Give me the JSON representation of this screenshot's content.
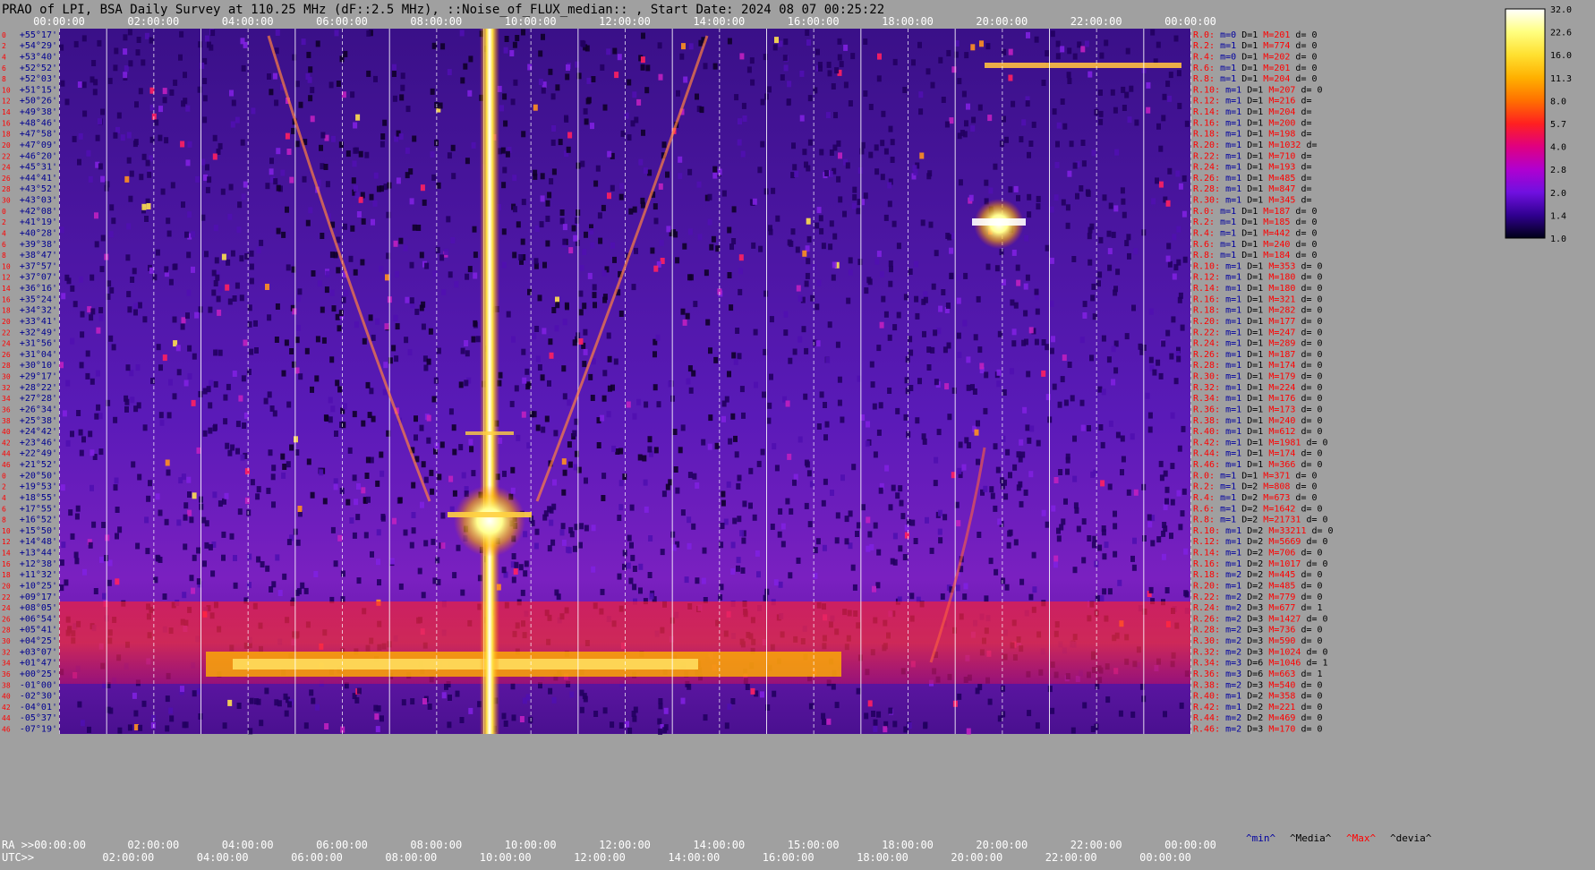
{
  "chart_data": {
    "type": "heatmap",
    "title": "PRAO of LPI, BSA Daily Survey at 110.25 MHz (dF::2.5 MHz), ::Noise_of_FLUX_median:: , Start Date: 2024 08 07 00:25:22",
    "x_top_ticks": [
      "00:00:00",
      "02:00:00",
      "04:00:00",
      "06:00:00",
      "08:00:00",
      "10:00:00",
      "12:00:00",
      "14:00:00",
      "16:00:00",
      "18:00:00",
      "20:00:00",
      "22:00:00",
      "00:00:00"
    ],
    "ra_label": "RA >>00:00:00",
    "ra_ticks": [
      "02:00:00",
      "04:00:00",
      "06:00:00",
      "08:00:00",
      "10:00:00",
      "12:00:00",
      "14:00:00",
      "15:00:00",
      "18:00:00",
      "20:00:00",
      "22:00:00",
      "00:00:00"
    ],
    "utc_label": "UTC>>",
    "utc_ticks": [
      "02:00:00",
      "04:00:00",
      "06:00:00",
      "08:00:00",
      "10:00:00",
      "12:00:00",
      "14:00:00",
      "16:00:00",
      "18:00:00",
      "20:00:00",
      "22:00:00",
      "00:00:00"
    ],
    "declinations": [
      "+55°17'",
      "+54°29'",
      "+53°40'",
      "+52°52'",
      "+52°03'",
      "+51°15'",
      "+50°26'",
      "+49°38'",
      "+48°46'",
      "+47°58'",
      "+47°09'",
      "+46°20'",
      "+45°31'",
      "+44°41'",
      "+43°52'",
      "+43°03'",
      "+42°08'",
      "+41°19'",
      "+40°28'",
      "+39°38'",
      "+38°47'",
      "+37°57'",
      "+37°07'",
      "+36°16'",
      "+35°24'",
      "+34°32'",
      "+33°41'",
      "+32°49'",
      "+31°56'",
      "+31°04'",
      "+30°10'",
      "+29°17'",
      "+28°22'",
      "+27°28'",
      "+26°34'",
      "+25°38'",
      "+24°42'",
      "+23°46'",
      "+22°49'",
      "+21°52'",
      "+20°50'",
      "+19°53'",
      "+18°55'",
      "+17°55'",
      "+16°52'",
      "+15°50'",
      "+14°48'",
      "+13°44'",
      "+12°38'",
      "+11°32'",
      "+10°25'",
      "+09°17'",
      "+08°05'",
      "+06°54'",
      "+05°41'",
      "+04°25'",
      "+03°07'",
      "+01°47'",
      "+00°25'",
      "-01°00'",
      "-02°30'",
      "-04°01'",
      "-05°37'",
      "-07°19'"
    ],
    "beam_numbers": [
      "0",
      "2",
      "4",
      "6",
      "8",
      "10",
      "12",
      "14",
      "16",
      "18",
      "20",
      "22",
      "24",
      "26",
      "28",
      "30",
      "0",
      "2",
      "4",
      "6",
      "8",
      "10",
      "12",
      "14",
      "16",
      "18",
      "20",
      "22",
      "24",
      "26",
      "28",
      "30",
      "32",
      "34",
      "36",
      "38",
      "40",
      "42",
      "44",
      "46",
      "0",
      "2",
      "4",
      "6",
      "8",
      "10",
      "12",
      "14",
      "16",
      "18",
      "20",
      "22",
      "24",
      "26",
      "28",
      "30",
      "32",
      "34",
      "36",
      "38",
      "40",
      "42",
      "44",
      "46"
    ],
    "row_stats": [
      {
        "r": "R.0:",
        "m": "m=0",
        "D": "D=1",
        "M": "M=201",
        "d": "d= 0"
      },
      {
        "r": "R.2:",
        "m": "m=1",
        "D": "D=1",
        "M": "M=774",
        "d": "d= 0"
      },
      {
        "r": "R.4:",
        "m": "m=0",
        "D": "D=1",
        "M": "M=202",
        "d": "d= 0"
      },
      {
        "r": "R.6:",
        "m": "m=1",
        "D": "D=1",
        "M": "M=201",
        "d": "d= 0"
      },
      {
        "r": "R.8:",
        "m": "m=1",
        "D": "D=1",
        "M": "M=204",
        "d": "d= 0"
      },
      {
        "r": "R.10:",
        "m": "m=1",
        "D": "D=1",
        "M": "M=207",
        "d": "d= 0"
      },
      {
        "r": "R.12:",
        "m": "m=1",
        "D": "D=1",
        "M": "M=216",
        "d": "d= "
      },
      {
        "r": "R.14:",
        "m": "m=1",
        "D": "D=1",
        "M": "M=204",
        "d": "d= "
      },
      {
        "r": "R.16:",
        "m": "m=1",
        "D": "D=1",
        "M": "M=200",
        "d": "d= "
      },
      {
        "r": "R.18:",
        "m": "m=1",
        "D": "D=1",
        "M": "M=198",
        "d": "d= "
      },
      {
        "r": "R.20:",
        "m": "m=1",
        "D": "D=1",
        "M": "M=1032",
        "d": "d="
      },
      {
        "r": "R.22:",
        "m": "m=1",
        "D": "D=1",
        "M": "M=710",
        "d": "d= "
      },
      {
        "r": "R.24:",
        "m": "m=1",
        "D": "D=1",
        "M": "M=193",
        "d": "d= "
      },
      {
        "r": "R.26:",
        "m": "m=1",
        "D": "D=1",
        "M": "M=485",
        "d": "d= "
      },
      {
        "r": "R.28:",
        "m": "m=1",
        "D": "D=1",
        "M": "M=847",
        "d": "d= "
      },
      {
        "r": "R.30:",
        "m": "m=1",
        "D": "D=1",
        "M": "M=345",
        "d": "d= "
      },
      {
        "r": "R.0:",
        "m": "m=1",
        "D": "D=1",
        "M": "M=187",
        "d": "d= 0"
      },
      {
        "r": "R.2:",
        "m": "m=1",
        "D": "D=1",
        "M": "M=185",
        "d": "d= 0"
      },
      {
        "r": "R.4:",
        "m": "m=1",
        "D": "D=1",
        "M": "M=442",
        "d": "d= 0"
      },
      {
        "r": "R.6:",
        "m": "m=1",
        "D": "D=1",
        "M": "M=240",
        "d": "d= 0"
      },
      {
        "r": "R.8:",
        "m": "m=1",
        "D": "D=1",
        "M": "M=184",
        "d": "d= 0"
      },
      {
        "r": "R.10:",
        "m": "m=1",
        "D": "D=1",
        "M": "M=353",
        "d": "d= 0"
      },
      {
        "r": "R.12:",
        "m": "m=1",
        "D": "D=1",
        "M": "M=180",
        "d": "d= 0"
      },
      {
        "r": "R.14:",
        "m": "m=1",
        "D": "D=1",
        "M": "M=180",
        "d": "d= 0"
      },
      {
        "r": "R.16:",
        "m": "m=1",
        "D": "D=1",
        "M": "M=321",
        "d": "d= 0"
      },
      {
        "r": "R.18:",
        "m": "m=1",
        "D": "D=1",
        "M": "M=282",
        "d": "d= 0"
      },
      {
        "r": "R.20:",
        "m": "m=1",
        "D": "D=1",
        "M": "M=177",
        "d": "d= 0"
      },
      {
        "r": "R.22:",
        "m": "m=1",
        "D": "D=1",
        "M": "M=247",
        "d": "d= 0"
      },
      {
        "r": "R.24:",
        "m": "m=1",
        "D": "D=1",
        "M": "M=289",
        "d": "d= 0"
      },
      {
        "r": "R.26:",
        "m": "m=1",
        "D": "D=1",
        "M": "M=187",
        "d": "d= 0"
      },
      {
        "r": "R.28:",
        "m": "m=1",
        "D": "D=1",
        "M": "M=174",
        "d": "d= 0"
      },
      {
        "r": "R.30:",
        "m": "m=1",
        "D": "D=1",
        "M": "M=179",
        "d": "d= 0"
      },
      {
        "r": "R.32:",
        "m": "m=1",
        "D": "D=1",
        "M": "M=224",
        "d": "d= 0"
      },
      {
        "r": "R.34:",
        "m": "m=1",
        "D": "D=1",
        "M": "M=176",
        "d": "d= 0"
      },
      {
        "r": "R.36:",
        "m": "m=1",
        "D": "D=1",
        "M": "M=173",
        "d": "d= 0"
      },
      {
        "r": "R.38:",
        "m": "m=1",
        "D": "D=1",
        "M": "M=240",
        "d": "d= 0"
      },
      {
        "r": "R.40:",
        "m": "m=1",
        "D": "D=1",
        "M": "M=612",
        "d": "d= 0"
      },
      {
        "r": "R.42:",
        "m": "m=1",
        "D": "D=1",
        "M": "M=1981",
        "d": "d= 0"
      },
      {
        "r": "R.44:",
        "m": "m=1",
        "D": "D=1",
        "M": "M=174",
        "d": "d= 0"
      },
      {
        "r": "R.46:",
        "m": "m=1",
        "D": "D=1",
        "M": "M=366",
        "d": "d= 0"
      },
      {
        "r": "R.0:",
        "m": "m=1",
        "D": "D=1",
        "M": "M=371",
        "d": "d= 0"
      },
      {
        "r": "R.2:",
        "m": "m=1",
        "D": "D=2",
        "M": "M=808",
        "d": "d= 0"
      },
      {
        "r": "R.4:",
        "m": "m=1",
        "D": "D=2",
        "M": "M=673",
        "d": "d= 0"
      },
      {
        "r": "R.6:",
        "m": "m=1",
        "D": "D=2",
        "M": "M=1642",
        "d": "d= 0"
      },
      {
        "r": "R.8:",
        "m": "m=1",
        "D": "D=2",
        "M": "M=21731",
        "d": "d= 0"
      },
      {
        "r": "R.10:",
        "m": "m=1",
        "D": "D=2",
        "M": "M=33211",
        "d": "d= 0"
      },
      {
        "r": "R.12:",
        "m": "m=1",
        "D": "D=2",
        "M": "M=5669",
        "d": "d= 0"
      },
      {
        "r": "R.14:",
        "m": "m=1",
        "D": "D=2",
        "M": "M=706",
        "d": "d= 0"
      },
      {
        "r": "R.16:",
        "m": "m=1",
        "D": "D=2",
        "M": "M=1017",
        "d": "d= 0"
      },
      {
        "r": "R.18:",
        "m": "m=2",
        "D": "D=2",
        "M": "M=445",
        "d": "d= 0"
      },
      {
        "r": "R.20:",
        "m": "m=1",
        "D": "D=2",
        "M": "M=485",
        "d": "d= 0"
      },
      {
        "r": "R.22:",
        "m": "m=2",
        "D": "D=2",
        "M": "M=779",
        "d": "d= 0"
      },
      {
        "r": "R.24:",
        "m": "m=2",
        "D": "D=3",
        "M": "M=677",
        "d": "d= 1"
      },
      {
        "r": "R.26:",
        "m": "m=2",
        "D": "D=3",
        "M": "M=1427",
        "d": "d= 0"
      },
      {
        "r": "R.28:",
        "m": "m=2",
        "D": "D=3",
        "M": "M=736",
        "d": "d= 0"
      },
      {
        "r": "R.30:",
        "m": "m=2",
        "D": "D=3",
        "M": "M=590",
        "d": "d= 0"
      },
      {
        "r": "R.32:",
        "m": "m=2",
        "D": "D=3",
        "M": "M=1024",
        "d": "d= 0"
      },
      {
        "r": "R.34:",
        "m": "m=3",
        "D": "D=6",
        "M": "M=1046",
        "d": "d= 1"
      },
      {
        "r": "R.36:",
        "m": "m=3",
        "D": "D=6",
        "M": "M=663",
        "d": "d= 1"
      },
      {
        "r": "R.38:",
        "m": "m=2",
        "D": "D=3",
        "M": "M=540",
        "d": "d= 0"
      },
      {
        "r": "R.40:",
        "m": "m=1",
        "D": "D=2",
        "M": "M=358",
        "d": "d= 0"
      },
      {
        "r": "R.42:",
        "m": "m=1",
        "D": "D=2",
        "M": "M=221",
        "d": "d= 0"
      },
      {
        "r": "R.44:",
        "m": "m=2",
        "D": "D=2",
        "M": "M=469",
        "d": "d= 0"
      },
      {
        "r": "R.46:",
        "m": "m=2",
        "D": "D=3",
        "M": "M=170",
        "d": "d= 0"
      }
    ],
    "footer_legend": [
      {
        "text": "^min^",
        "color": "#0000a0"
      },
      {
        "text": "^Media^",
        "color": "#000000"
      },
      {
        "text": "^Max^",
        "color": "#ff0000"
      },
      {
        "text": "^devia^",
        "color": "#000000"
      }
    ],
    "colorbar": {
      "ticks": [
        "32.0",
        "22.6",
        "16.0",
        "11.3",
        "8.0",
        "5.7",
        "4.0",
        "2.8",
        "2.0",
        "1.4",
        "1.0"
      ],
      "colors": [
        "#ffffff",
        "#ffff80",
        "#ffe030",
        "#ffb000",
        "#ff7000",
        "#ff2020",
        "#e00080",
        "#b000d0",
        "#7010e0",
        "#300090",
        "#000018"
      ]
    },
    "features": {
      "bright_transit_utc_hours": 9.45,
      "equatorial_band_dec_rows": [
        52,
        63
      ],
      "hot_spot_utc_hours": 20.1
    },
    "colors": {
      "background": "#a0a0a0",
      "title_text": "#000000",
      "tick_text": "#ffffff",
      "dec_label": "#000090",
      "beam_label": "#ff0000",
      "stat_r": "#ff0000",
      "stat_m": "#0000a0",
      "stat_D": "#000000",
      "stat_M": "#ff0000",
      "stat_d": "#000000"
    }
  }
}
